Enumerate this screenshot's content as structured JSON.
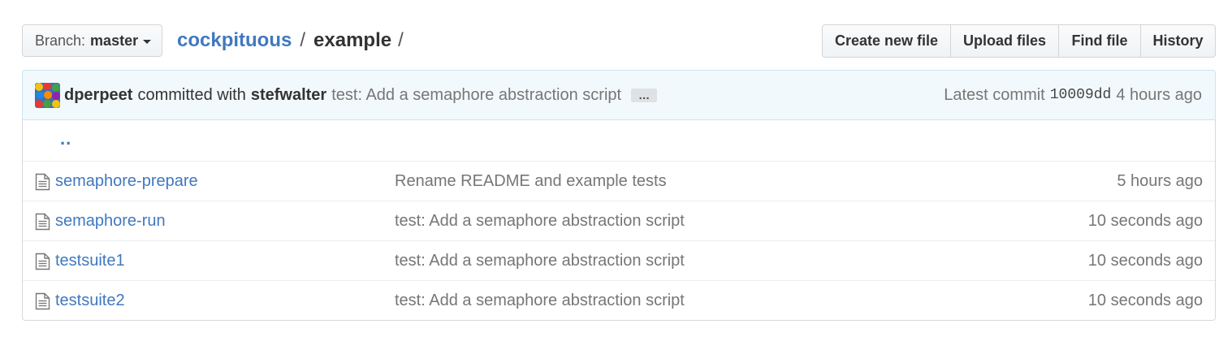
{
  "branch": {
    "prefix": "Branch:",
    "name": "master"
  },
  "breadcrumb": {
    "repo": "cockpituous",
    "separator": "/",
    "current": "example",
    "trailing": "/"
  },
  "actions": [
    "Create new file",
    "Upload files",
    "Find file",
    "History"
  ],
  "commit": {
    "author": "dperpeet",
    "with_text": "committed with",
    "committer": "stefwalter",
    "message": "test: Add a semaphore abstraction script",
    "ellipsis": "…",
    "latest_label": "Latest commit",
    "sha": "10009dd",
    "age": "4 hours ago"
  },
  "parent_link": "..",
  "files": [
    {
      "name": "semaphore-prepare",
      "message": "Rename README and example tests",
      "age": "5 hours ago"
    },
    {
      "name": "semaphore-run",
      "message": "test: Add a semaphore abstraction script",
      "age": "10 seconds ago"
    },
    {
      "name": "testsuite1",
      "message": "test: Add a semaphore abstraction script",
      "age": "10 seconds ago"
    },
    {
      "name": "testsuite2",
      "message": "test: Add a semaphore abstraction script",
      "age": "10 seconds ago"
    }
  ],
  "colors": {
    "link": "#4078c0",
    "muted": "#767676",
    "commit_bg": "#f2f9fc",
    "commit_border": "#c9e6f2"
  },
  "icons": {
    "file": "file-text-icon",
    "caret": "chevron-down-icon",
    "avatar": "avatar"
  }
}
